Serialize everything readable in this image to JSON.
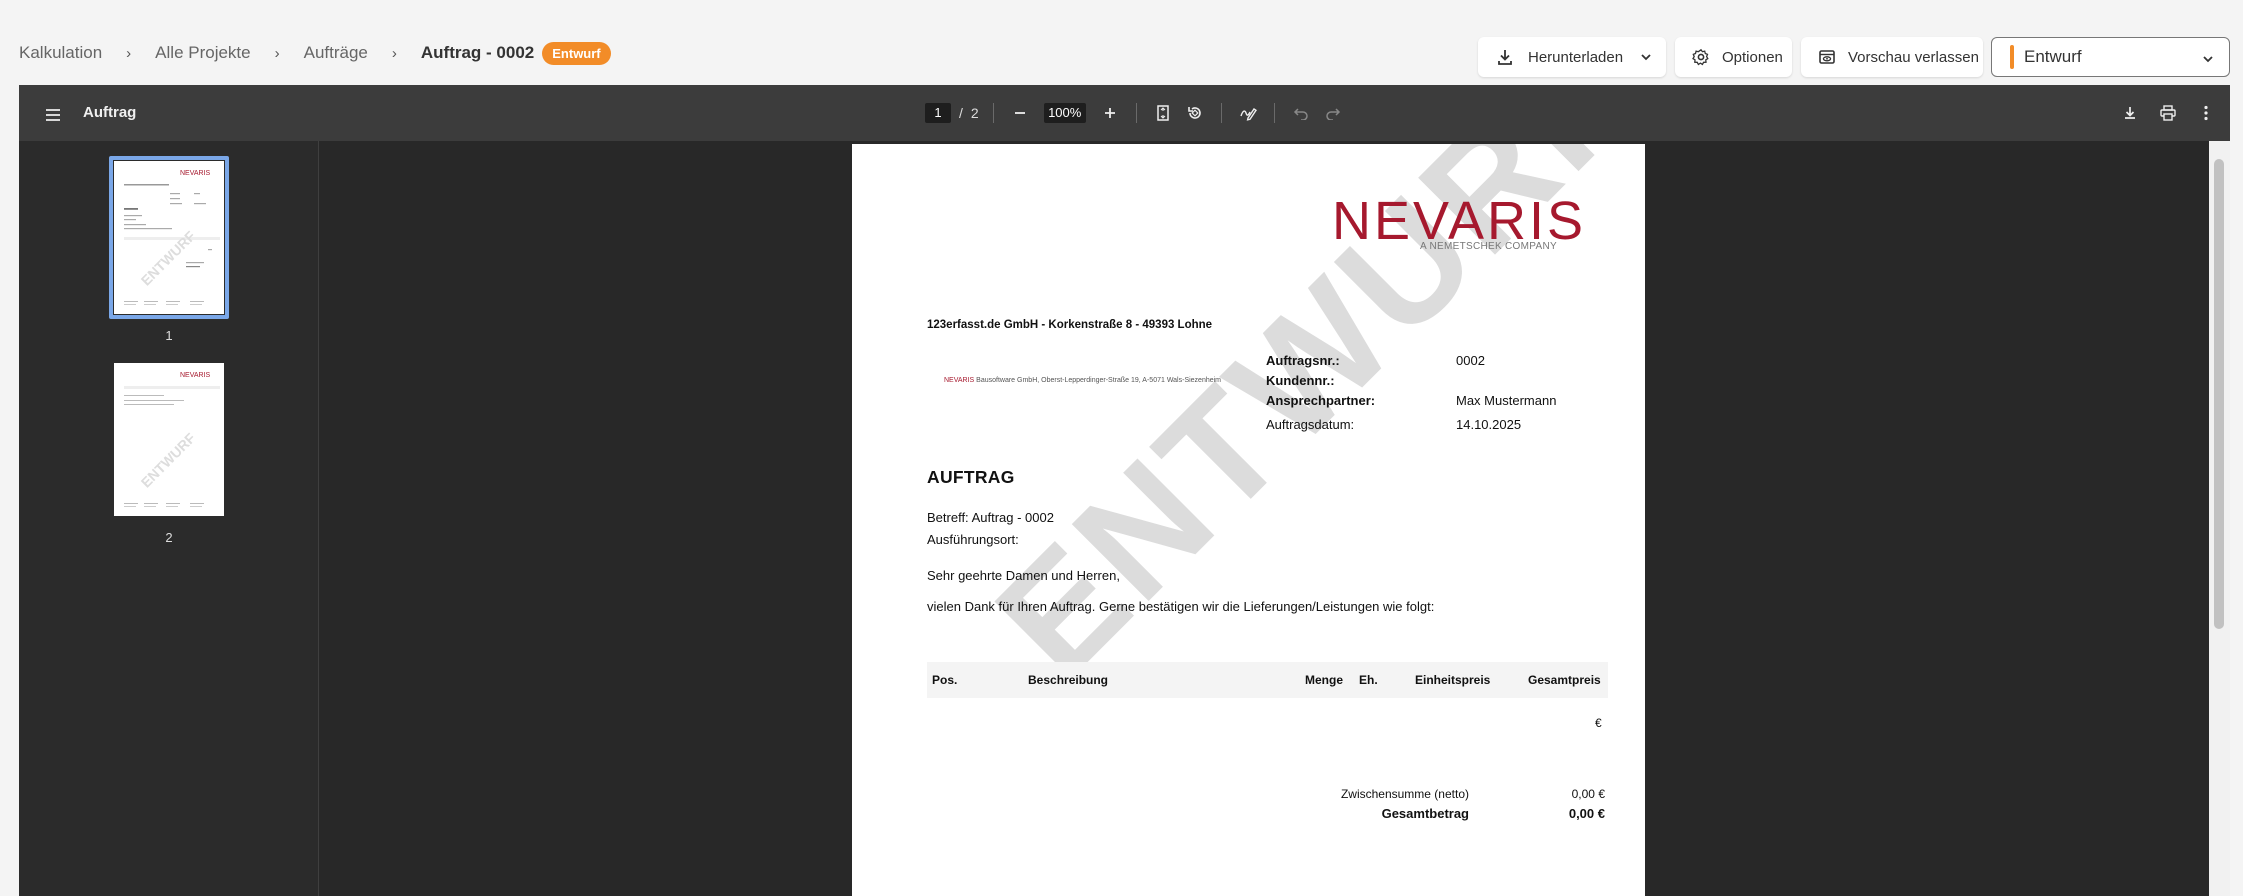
{
  "breadcrumb": {
    "items": [
      "Kalkulation",
      "Alle Projekte",
      "Aufträge"
    ],
    "current": "Auftrag - 0002",
    "badge": "Entwurf",
    "separator": "›"
  },
  "actions": {
    "download_label": "Herunterladen",
    "options_label": "Optionen",
    "preview_label": "Vorschau verlassen",
    "status_value": "Entwurf"
  },
  "viewer": {
    "title": "Auftrag",
    "page_current": "1",
    "page_separator": "/",
    "page_total": "2",
    "zoom": "100%",
    "thumbnails": [
      {
        "label": "1",
        "selected": true
      },
      {
        "label": "2",
        "selected": false
      }
    ]
  },
  "document": {
    "logo": "NEVARIS",
    "logo_sub": "A NEMETSCHEK COMPANY",
    "sender_line": "123erfasst.de GmbH - Korkenstraße 8 - 49393 Lohne",
    "small_address_brand": "NEVARIS",
    "small_address": " Bausoftware GmbH, Oberst-Lepperdinger-Straße 19, A-5071 Wals-Siezenheim",
    "meta": {
      "order_no_label": "Auftragsnr.:",
      "order_no": "0002",
      "customer_no_label": "Kundennr.:",
      "customer_no": "",
      "contact_label": "Ansprechpartner:",
      "contact": "Max Mustermann",
      "date_label": "Auftragsdatum:",
      "date": "14.10.2025"
    },
    "heading": "AUFTRAG",
    "subject": "Betreff: Auftrag - 0002",
    "location": "Ausführungsort:",
    "salutation": "Sehr geehrte Damen und Herren,",
    "intro": "vielen Dank für Ihren Auftrag. Gerne bestätigen wir die Lieferungen/Leistungen wie folgt:",
    "table_headers": {
      "pos": "Pos.",
      "description": "Beschreibung",
      "quantity": "Menge",
      "unit": "Eh.",
      "unit_price": "Einheitspreis",
      "total_price": "Gesamtpreis"
    },
    "currency_cell": "€",
    "subtotal_label": "Zwischensumme (netto)",
    "subtotal_value": "0,00 €",
    "total_label": "Gesamtbetrag",
    "total_value": "0,00 €",
    "watermark": "ENTWURF"
  },
  "colors": {
    "badge": "#f28c28",
    "brand_red": "#a6192e",
    "viewer_bg": "#282828",
    "viewer_toolbar": "#3c3c3c",
    "thumb_selected": "#7aa7e8"
  },
  "icons": [
    "download-icon",
    "chevron-down-icon",
    "gear-icon",
    "preview-exit-icon",
    "menu-icon",
    "minus-icon",
    "plus-icon",
    "fit-page-icon",
    "rotate-icon",
    "annotate-icon",
    "undo-icon",
    "redo-icon",
    "print-icon",
    "more-vert-icon"
  ]
}
